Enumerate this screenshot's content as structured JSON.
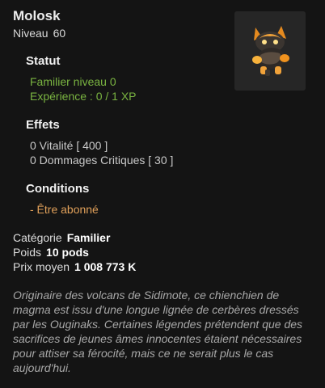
{
  "item": {
    "name": "Molosk",
    "level_label": "Niveau",
    "level_value": "60",
    "image_icon": "molosk-pet-icon"
  },
  "statut": {
    "title": "Statut",
    "lines": [
      "Familier niveau 0",
      "Expérience : 0 / 1 XP"
    ]
  },
  "effets": {
    "title": "Effets",
    "lines": [
      "0 Vitalité  [ 400 ]",
      "0 Dommages Critiques  [ 30 ]"
    ]
  },
  "conditions": {
    "title": "Conditions",
    "lines": [
      "- Être abonné"
    ]
  },
  "details": {
    "category_label": "Catégorie",
    "category_value": "Familier",
    "weight_label": "Poids",
    "weight_value": "10 pods",
    "price_label": "Prix moyen",
    "price_value": "1 008 773 K"
  },
  "description": "Originaire des volcans de Sidimote, ce chienchien de magma est issu d'une longue lignée de cerbères dressés par les Ouginaks. Certaines légendes prétendent que des sacrifices de jeunes âmes innocentes étaient nécessaires pour attiser sa férocité, mais ce ne serait plus le cas aujourd'hui.",
  "colors": {
    "background": "#141414",
    "statut_text": "#7ab441",
    "effets_text": "#c9c9c9",
    "conditions_text": "#e0a05a"
  }
}
